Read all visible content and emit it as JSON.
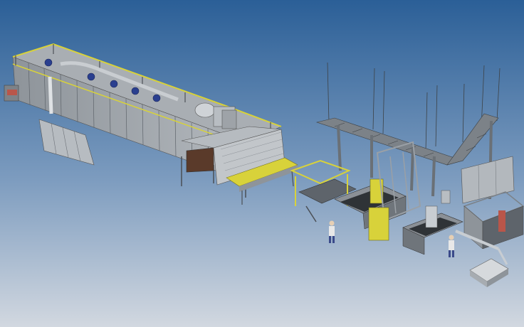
{
  "colors": {
    "sky_top": "#2b5f97",
    "sky_bottom": "#cfd6e0",
    "machine_gray": "#9aa0a6",
    "machine_dark": "#5e646b",
    "accent_yellow": "#d8d23a",
    "motor_blue": "#2a3f8f",
    "gantry_gray": "#7c8288"
  },
  "icons": {
    "operator": "human-operator-figure"
  }
}
